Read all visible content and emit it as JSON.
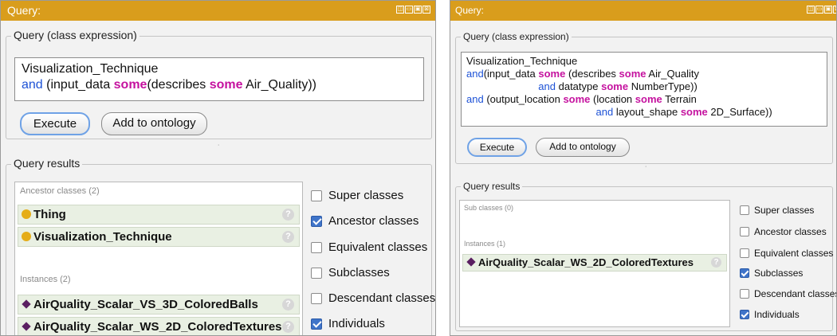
{
  "left": {
    "title": "Query:",
    "query_group_label": "Query (class expression)",
    "query": {
      "line1": "Visualization_Technique",
      "line2_kw": "and",
      "line2_a": " (input_data ",
      "line2_some1": "some",
      "line2_b": "(describes ",
      "line2_some2": "some",
      "line2_c": " Air_Quality))"
    },
    "execute_label": "Execute",
    "add_label": "Add to ontology",
    "results_label": "Query results",
    "ancestor_header": "Ancestor classes (2)",
    "ancestors": [
      "Thing",
      "Visualization_Technique"
    ],
    "instances_header": "Instances (2)",
    "instances": [
      "AirQuality_Scalar_VS_3D_ColoredBalls",
      "AirQuality_Scalar_WS_2D_ColoredTextures"
    ],
    "options": [
      {
        "label": "Super classes",
        "checked": false
      },
      {
        "label": "Ancestor classes",
        "checked": true
      },
      {
        "label": "Equivalent classes",
        "checked": false
      },
      {
        "label": "Subclasses",
        "checked": false
      },
      {
        "label": "Descendant classes",
        "checked": false
      },
      {
        "label": "Individuals",
        "checked": true
      }
    ]
  },
  "right": {
    "title": "Query:",
    "query_group_label": "Query (class expression)",
    "query": {
      "l1": "Visualization_Technique",
      "l2_and": "and",
      "l2_a": "(input_data ",
      "l2_some1": "some",
      "l2_b": " (describes ",
      "l2_some2": "some",
      "l2_c": " Air_Quality",
      "l3_and": "and",
      "l3_a": " datatype ",
      "l3_some": "some",
      "l3_b": " NumberType))",
      "l4_and": "and",
      "l4_a": " (output_location ",
      "l4_some1": "some",
      "l4_b": " (location ",
      "l4_some2": "some",
      "l4_c": " Terrain",
      "l5_and": "and",
      "l5_a": " layout_shape ",
      "l5_some": "some",
      "l5_b": " 2D_Surface))"
    },
    "execute_label": "Execute",
    "add_label": "Add to ontology",
    "results_label": "Query results",
    "subclasses_header": "Sub classes (0)",
    "instances_header": "Instances (1)",
    "instances": [
      "AirQuality_Scalar_WS_2D_ColoredTextures"
    ],
    "options": [
      {
        "label": "Super classes",
        "checked": false
      },
      {
        "label": "Ancestor classes",
        "checked": false
      },
      {
        "label": "Equivalent classes",
        "checked": false
      },
      {
        "label": "Subclasses",
        "checked": true
      },
      {
        "label": "Descendant classes",
        "checked": false
      },
      {
        "label": "Individuals",
        "checked": true
      }
    ]
  },
  "icons": {
    "window_buttons": [
      "◫",
      "▭",
      "▣",
      "⊠"
    ],
    "help": "?",
    "grip": "˙"
  },
  "colors": {
    "titlebar": "#d99d1c",
    "keyword_and": "#1d52d6",
    "keyword_some": "#c5129f",
    "checkbox_checked": "#3f74c9",
    "class_dot": "#e5ad19",
    "individual_diamond": "#5a1f61"
  }
}
